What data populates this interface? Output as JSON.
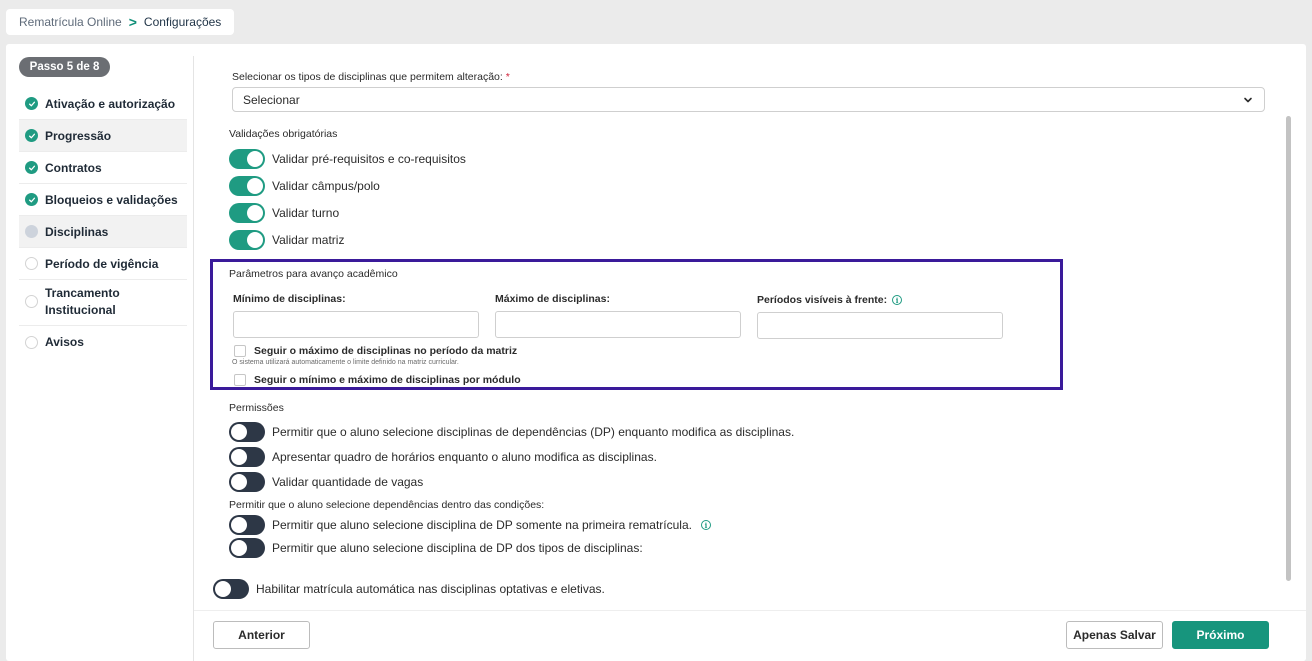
{
  "breadcrumb": {
    "root": "Rematrícula Online",
    "separator": ">",
    "current": "Configurações"
  },
  "sidebar": {
    "step_badge": "Passo 5 de 8",
    "items": [
      {
        "label": "Ativação e autorização",
        "status": "done"
      },
      {
        "label": "Progressão",
        "status": "done"
      },
      {
        "label": "Contratos",
        "status": "done"
      },
      {
        "label": "Bloqueios e validações",
        "status": "done"
      },
      {
        "label": "Disciplinas",
        "status": "current"
      },
      {
        "label": "Período de vigência",
        "status": "todo"
      },
      {
        "label": "Trancamento Institucional",
        "status": "todo"
      },
      {
        "label": "Avisos",
        "status": "todo"
      }
    ]
  },
  "content": {
    "select_types": {
      "label": "Selecionar os tipos de disciplinas que permitem alteração:",
      "required_mark": "*",
      "value": "Selecionar",
      "icon": "chevron-down-icon"
    },
    "validations": {
      "title": "Validações obrigatórias",
      "toggles": [
        {
          "label": "Validar pré-requisitos e co-requisitos",
          "on": true
        },
        {
          "label": "Validar câmpus/polo",
          "on": true
        },
        {
          "label": "Validar turno",
          "on": true
        },
        {
          "label": "Validar matriz",
          "on": true
        }
      ]
    },
    "params": {
      "title": "Parâmetros para avanço acadêmico",
      "min_label": "Mínimo de disciplinas:",
      "min_value": "",
      "max_label": "Máximo de disciplinas:",
      "max_value": "",
      "periods_label": "Períodos visíveis à frente:",
      "periods_value": "",
      "check_max_label": "Seguir o máximo de disciplinas no período da matriz",
      "check_max_hint": "O sistema utilizará automaticamente o limite definido na matriz curricular.",
      "check_module_label": "Seguir o mínimo e máximo de disciplinas por módulo"
    },
    "permissions": {
      "title": "Permissões",
      "toggles": [
        {
          "label": "Permitir que o aluno selecione disciplinas de dependências (DP) enquanto modifica as disciplinas.",
          "on": false
        },
        {
          "label": "Apresentar quadro de horários enquanto o aluno modifica as disciplinas.",
          "on": false
        },
        {
          "label": "Validar quantidade de vagas",
          "on": false
        }
      ],
      "conditions_title": "Permitir que o aluno selecione dependências dentro das condições:",
      "conditions": [
        {
          "label": "Permitir que aluno selecione disciplina de DP somente na primeira rematrícula.",
          "on": false,
          "info": true
        },
        {
          "label": "Permitir que aluno selecione disciplina de DP dos tipos de disciplinas:",
          "on": false
        }
      ]
    },
    "auto_enroll": {
      "label": "Habilitar matrícula automática nas disciplinas optativas e eletivas.",
      "on": false
    }
  },
  "footer": {
    "previous_label": "Anterior",
    "save_only_label": "Apenas Salvar",
    "next_label": "Próximo"
  },
  "colors": {
    "accent": "#1f9b82",
    "toggle_off": "#2d3746",
    "highlight_border": "#3a1a9a",
    "required": "#d0223a"
  }
}
